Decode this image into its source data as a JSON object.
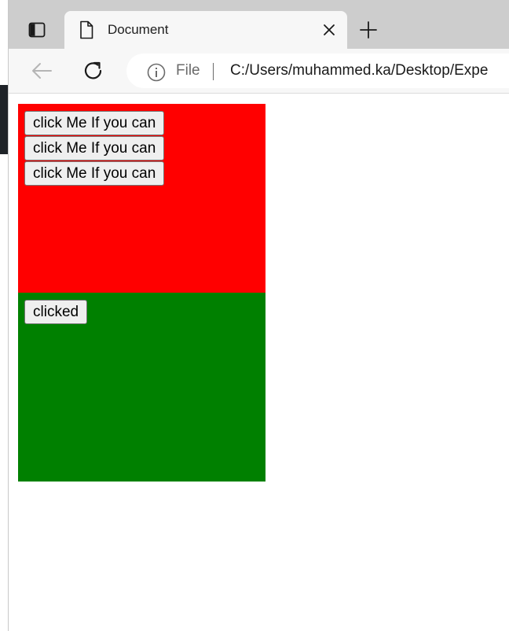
{
  "browser": {
    "tab_title": "Document",
    "address_scheme": "File",
    "address_url": "C:/Users/muhammed.ka/Desktop/Expe"
  },
  "page": {
    "red_box": {
      "color": "#ff0000",
      "buttons": [
        {
          "label": "click Me If you can"
        },
        {
          "label": "click Me If you can"
        },
        {
          "label": "click Me If you can"
        }
      ]
    },
    "green_box": {
      "color": "#008000",
      "buttons": [
        {
          "label": "clicked"
        }
      ]
    }
  }
}
